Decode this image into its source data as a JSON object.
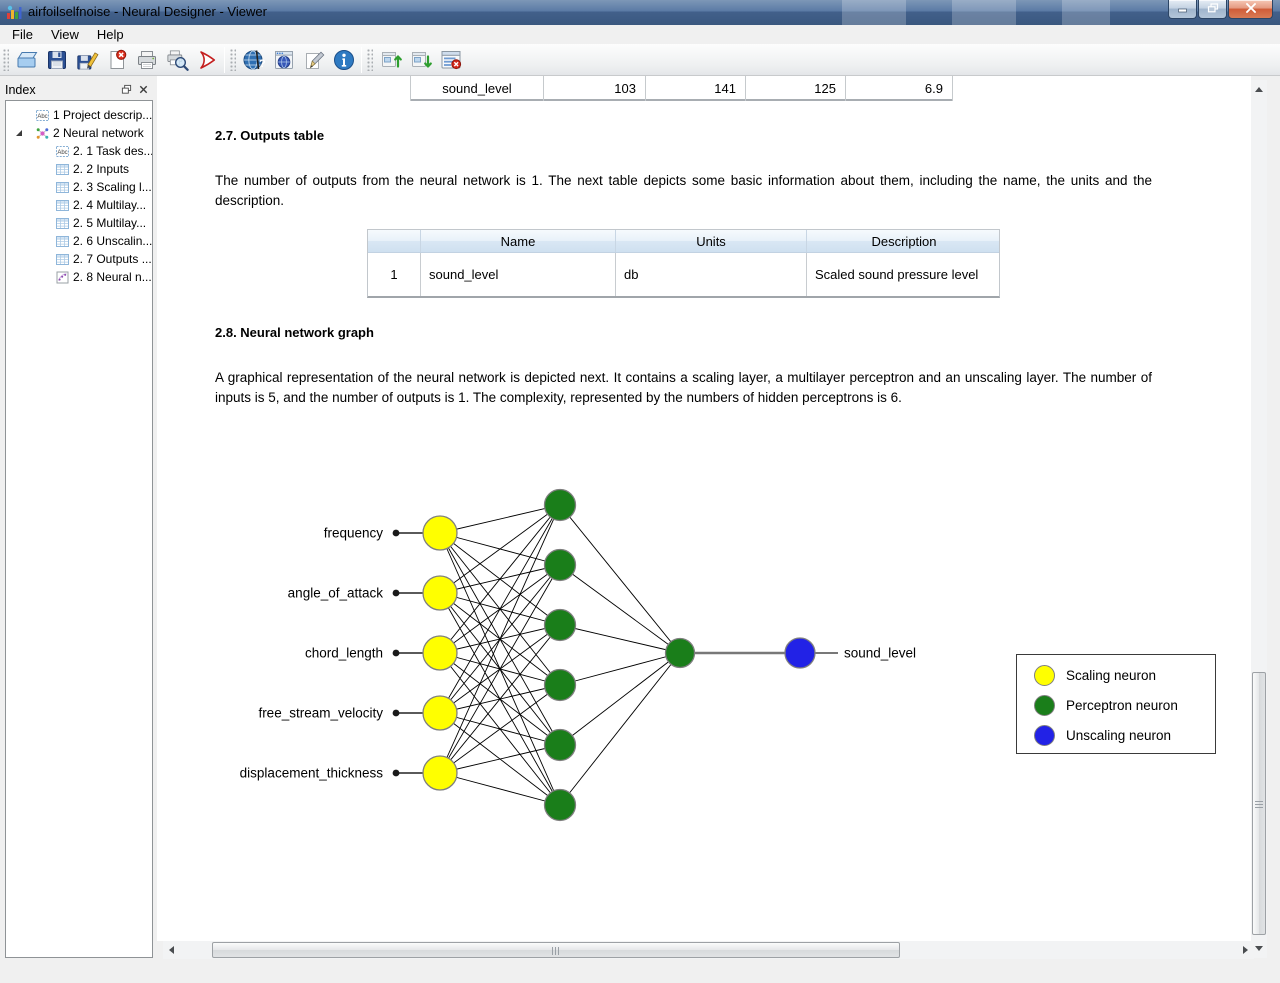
{
  "window": {
    "title": "airfoilselfnoise - Neural Designer - Viewer",
    "control_icons": [
      "minimize-icon",
      "restore-icon",
      "close-icon"
    ]
  },
  "menu": {
    "items": [
      "File",
      "View",
      "Help"
    ]
  },
  "toolbar": {
    "groups": [
      [
        "open-icon",
        "save-icon",
        "save-as-icon",
        "delete-page-icon",
        "print-icon",
        "print-preview-icon",
        "export-pdf-icon"
      ],
      [
        "help-globe-icon",
        "web-icon",
        "edit-icon",
        "about-icon"
      ],
      [
        "move-up-icon",
        "move-down-icon",
        "close-report-icon"
      ]
    ]
  },
  "sidebar": {
    "title": "Index",
    "header_icons": [
      "float-panel-icon",
      "close-panel-icon"
    ],
    "tree": [
      {
        "label": "1 Project descrip...",
        "icon": "abc-icon",
        "level": 1
      },
      {
        "label": "2 Neural network",
        "icon": "neural-icon",
        "level": 1,
        "expanded": true
      },
      {
        "label": "2. 1 Task des...",
        "icon": "abc-icon",
        "level": 2
      },
      {
        "label": "2. 2 Inputs",
        "icon": "table-icon",
        "level": 2
      },
      {
        "label": "2. 3 Scaling l...",
        "icon": "table-icon",
        "level": 2
      },
      {
        "label": "2. 4 Multilay...",
        "icon": "table-icon",
        "level": 2
      },
      {
        "label": "2. 5 Multilay...",
        "icon": "table-icon",
        "level": 2
      },
      {
        "label": "2. 6 Unscalin...",
        "icon": "table-icon",
        "level": 2
      },
      {
        "label": "2. 7 Outputs ...",
        "icon": "table-icon",
        "level": 2
      },
      {
        "label": "2. 8 Neural n...",
        "icon": "scatter-icon",
        "level": 2
      }
    ]
  },
  "content": {
    "stats_row": {
      "label": "sound_level",
      "values": [
        "103",
        "141",
        "125",
        "6.9"
      ]
    },
    "sections": [
      {
        "heading": "2.7. Outputs table",
        "paragraph": "The number of outputs from the neural network is 1. The next table depicts some basic information about them, including the name, the units and the description."
      },
      {
        "heading": "2.8. Neural network graph",
        "paragraph": "A graphical representation of the neural network is depicted next. It contains a scaling layer, a multilayer perceptron and an unscaling layer. The number of inputs is 5, and the number of outputs is 1. The complexity, represented by the numbers of hidden perceptrons is 6."
      }
    ],
    "outputs_table": {
      "headers": [
        "",
        "Name",
        "Units",
        "Description"
      ],
      "rows": [
        [
          "1",
          "sound_level",
          "db",
          "Scaled sound pressure level"
        ]
      ]
    },
    "network": {
      "inputs": [
        "frequency",
        "angle_of_attack",
        "chord_length",
        "free_stream_velocity",
        "displacement_thickness"
      ],
      "hidden_neurons": 6,
      "output_neurons": 1,
      "output_label": "sound_level",
      "colors": {
        "scaling": "#ffff00",
        "perceptron": "#1a7e1a",
        "unscaling": "#2222e6"
      },
      "legend": [
        {
          "label": "Scaling neuron",
          "color": "#ffff00"
        },
        {
          "label": "Perceptron neuron",
          "color": "#1a7e1a"
        },
        {
          "label": "Unscaling neuron",
          "color": "#2222e6"
        }
      ]
    }
  }
}
